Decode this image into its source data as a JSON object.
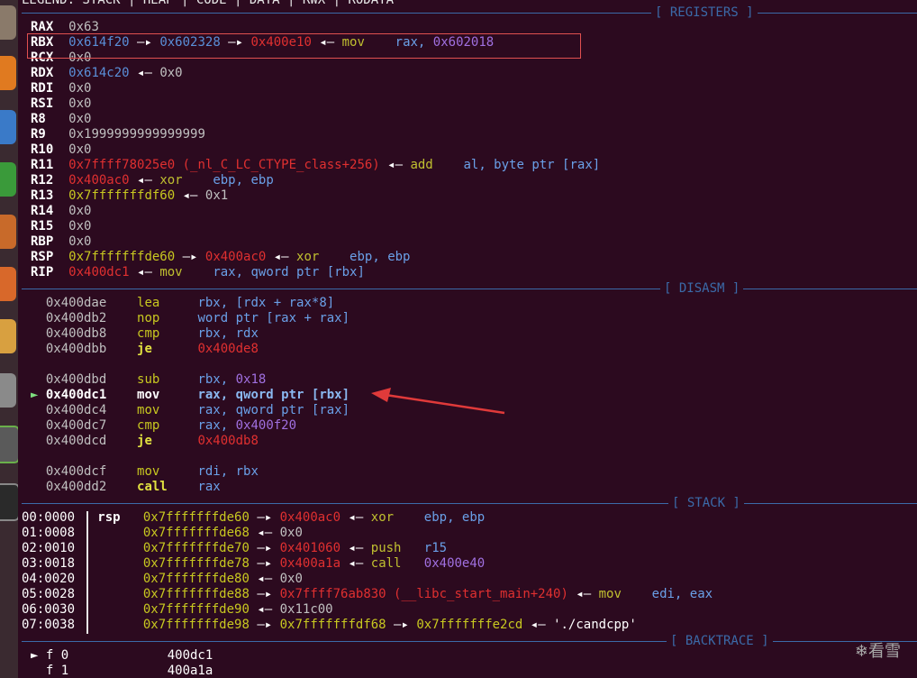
{
  "legend": "LEGEND: STACK | HEAP | CODE | DATA | RWX | RODATA",
  "sections": {
    "registers": "[ REGISTERS ]",
    "disasm": "[ DISASM ]",
    "stack": "[ STACK ]",
    "backtrace": "[ BACKTRACE ]"
  },
  "registers": [
    {
      "name": "RAX",
      "parts": [
        [
          "0x63",
          "c-addr"
        ]
      ]
    },
    {
      "name": "RBX",
      "parts": [
        [
          "0x614f20",
          "c-heap"
        ],
        [
          " —▸ ",
          "c-op"
        ],
        [
          "0x602328",
          "c-heap"
        ],
        [
          " —▸ ",
          "c-op"
        ],
        [
          "0x400e10",
          "c-code"
        ],
        [
          " ◂— ",
          "c-op"
        ],
        [
          "mov",
          "c-ins"
        ],
        [
          "    rax, ",
          "c-opr"
        ],
        [
          "0x602018",
          "c-data"
        ]
      ]
    },
    {
      "name": "RCX",
      "parts": [
        [
          "0x0",
          "c-addr"
        ]
      ]
    },
    {
      "name": "RDX",
      "parts": [
        [
          "0x614c20",
          "c-heap"
        ],
        [
          " ◂— ",
          "c-op"
        ],
        [
          "0x0",
          "c-addr"
        ]
      ]
    },
    {
      "name": "RDI",
      "parts": [
        [
          "0x0",
          "c-addr"
        ]
      ]
    },
    {
      "name": "RSI",
      "parts": [
        [
          "0x0",
          "c-addr"
        ]
      ]
    },
    {
      "name": "R8",
      "parts": [
        [
          "0x0",
          "c-addr"
        ]
      ]
    },
    {
      "name": "R9",
      "parts": [
        [
          "0x1999999999999999",
          "c-addr"
        ]
      ]
    },
    {
      "name": "R10",
      "parts": [
        [
          "0x0",
          "c-addr"
        ]
      ]
    },
    {
      "name": "R11",
      "parts": [
        [
          "0x7ffff78025e0 (_nl_C_LC_CTYPE_class+256)",
          "c-code"
        ],
        [
          " ◂— ",
          "c-op"
        ],
        [
          "add",
          "c-ins"
        ],
        [
          "    al, byte ptr [rax]",
          "c-opr"
        ]
      ]
    },
    {
      "name": "R12",
      "parts": [
        [
          "0x400ac0",
          "c-code"
        ],
        [
          " ◂— ",
          "c-op"
        ],
        [
          "xor",
          "c-ins"
        ],
        [
          "    ebp, ebp",
          "c-opr"
        ]
      ]
    },
    {
      "name": "R13",
      "parts": [
        [
          "0x7fffffffdf60",
          "c-stack"
        ],
        [
          " ◂— ",
          "c-op"
        ],
        [
          "0x1",
          "c-addr"
        ]
      ]
    },
    {
      "name": "R14",
      "parts": [
        [
          "0x0",
          "c-addr"
        ]
      ]
    },
    {
      "name": "R15",
      "parts": [
        [
          "0x0",
          "c-addr"
        ]
      ]
    },
    {
      "name": "RBP",
      "parts": [
        [
          "0x0",
          "c-addr"
        ]
      ]
    },
    {
      "name": "RSP",
      "parts": [
        [
          "0x7fffffffde60",
          "c-stack"
        ],
        [
          " —▸ ",
          "c-op"
        ],
        [
          "0x400ac0",
          "c-code"
        ],
        [
          " ◂— ",
          "c-op"
        ],
        [
          "xor",
          "c-ins"
        ],
        [
          "    ebp, ebp",
          "c-opr"
        ]
      ]
    },
    {
      "name": "RIP",
      "parts": [
        [
          "0x400dc1",
          "c-code"
        ],
        [
          " ◂— ",
          "c-op"
        ],
        [
          "mov",
          "c-ins"
        ],
        [
          "    rax, qword ptr [rbx]",
          "c-opr"
        ]
      ]
    }
  ],
  "disasm": [
    {
      "addr": "0x400dae",
      "mn": "lea",
      "ops": [
        [
          "rbx, [rdx + rax*8]",
          "c-opr"
        ]
      ]
    },
    {
      "addr": "0x400db2",
      "mn": "nop",
      "ops": [
        [
          "word ptr [rax + rax]",
          "c-opr"
        ]
      ]
    },
    {
      "addr": "0x400db8",
      "mn": "cmp",
      "ops": [
        [
          "rbx, rdx",
          "c-opr"
        ]
      ]
    },
    {
      "addr": "0x400dbb",
      "mn": "je",
      "bold": true,
      "ops": [
        [
          "0x400de8",
          "c-code"
        ]
      ]
    },
    {
      "blank": true
    },
    {
      "addr": "0x400dbd",
      "mn": "sub",
      "ops": [
        [
          "rbx, ",
          "c-opr"
        ],
        [
          "0x18",
          "c-data"
        ]
      ]
    },
    {
      "addr": "0x400dc1",
      "mn": "mov",
      "current": true,
      "marker": "►",
      "ops": [
        [
          "rax, qword ptr [rbx]",
          "c-curo"
        ]
      ]
    },
    {
      "addr": "0x400dc4",
      "mn": "mov",
      "ops": [
        [
          "rax, qword ptr [rax]",
          "c-opr"
        ]
      ]
    },
    {
      "addr": "0x400dc7",
      "mn": "cmp",
      "ops": [
        [
          "rax, ",
          "c-opr"
        ],
        [
          "0x400f20",
          "c-data"
        ]
      ]
    },
    {
      "addr": "0x400dcd",
      "mn": "je",
      "bold": true,
      "ops": [
        [
          "0x400db8",
          "c-code"
        ]
      ]
    },
    {
      "blank": true
    },
    {
      "addr": "0x400dcf",
      "mn": "mov",
      "ops": [
        [
          "rdi, rbx",
          "c-opr"
        ]
      ]
    },
    {
      "addr": "0x400dd2",
      "mn": "call",
      "bold": true,
      "ops": [
        [
          "rax",
          "c-opr"
        ]
      ]
    }
  ],
  "stack": [
    {
      "idx": "00:0000",
      "reg": "rsp",
      "parts": [
        [
          "0x7fffffffde60",
          "c-stack"
        ],
        [
          " —▸ ",
          "c-op"
        ],
        [
          "0x400ac0",
          "c-code"
        ],
        [
          " ◂— ",
          "c-op"
        ],
        [
          "xor",
          "c-ins"
        ],
        [
          "    ebp, ebp",
          "c-opr"
        ]
      ]
    },
    {
      "idx": "01:0008",
      "reg": "",
      "parts": [
        [
          "0x7fffffffde68",
          "c-stack"
        ],
        [
          " ◂— ",
          "c-op"
        ],
        [
          "0x0",
          "c-addr"
        ]
      ]
    },
    {
      "idx": "02:0010",
      "reg": "",
      "parts": [
        [
          "0x7fffffffde70",
          "c-stack"
        ],
        [
          " —▸ ",
          "c-op"
        ],
        [
          "0x401060",
          "c-code"
        ],
        [
          " ◂— ",
          "c-op"
        ],
        [
          "push",
          "c-ins"
        ],
        [
          "   r15",
          "c-opr"
        ]
      ]
    },
    {
      "idx": "03:0018",
      "reg": "",
      "parts": [
        [
          "0x7fffffffde78",
          "c-stack"
        ],
        [
          " —▸ ",
          "c-op"
        ],
        [
          "0x400a1a",
          "c-code"
        ],
        [
          " ◂— ",
          "c-op"
        ],
        [
          "call",
          "c-ins"
        ],
        [
          "   ",
          "c-opr"
        ],
        [
          "0x400e40",
          "c-data"
        ]
      ]
    },
    {
      "idx": "04:0020",
      "reg": "",
      "parts": [
        [
          "0x7fffffffde80",
          "c-stack"
        ],
        [
          " ◂— ",
          "c-op"
        ],
        [
          "0x0",
          "c-addr"
        ]
      ]
    },
    {
      "idx": "05:0028",
      "reg": "",
      "parts": [
        [
          "0x7fffffffde88",
          "c-stack"
        ],
        [
          " —▸ ",
          "c-op"
        ],
        [
          "0x7ffff76ab830 (__libc_start_main+240)",
          "c-code"
        ],
        [
          " ◂— ",
          "c-op"
        ],
        [
          "mov",
          "c-ins"
        ],
        [
          "    edi, eax",
          "c-opr"
        ]
      ]
    },
    {
      "idx": "06:0030",
      "reg": "",
      "parts": [
        [
          "0x7fffffffde90",
          "c-stack"
        ],
        [
          " ◂— ",
          "c-op"
        ],
        [
          "0x11c00",
          "c-addr"
        ]
      ]
    },
    {
      "idx": "07:0038",
      "reg": "",
      "parts": [
        [
          "0x7fffffffde98",
          "c-stack"
        ],
        [
          " —▸ ",
          "c-op"
        ],
        [
          "0x7fffffffdf68",
          "c-stack"
        ],
        [
          " —▸ ",
          "c-op"
        ],
        [
          "0x7fffffffe2cd",
          "c-stack"
        ],
        [
          " ◂— ",
          "c-op"
        ],
        [
          "'./candcpp'",
          "c-str"
        ]
      ]
    }
  ],
  "backtrace": [
    {
      "marker": "►",
      "frame": "f 0",
      "addr": "400dc1"
    },
    {
      "marker": "",
      "frame": "f 1",
      "addr": "400a1a"
    }
  ],
  "watermark": "❄看雪",
  "colors": {
    "background": "#2c0a1f",
    "separator": "#3b6aa8",
    "highlight": "#e05050",
    "arrow": "#e03a3a"
  }
}
